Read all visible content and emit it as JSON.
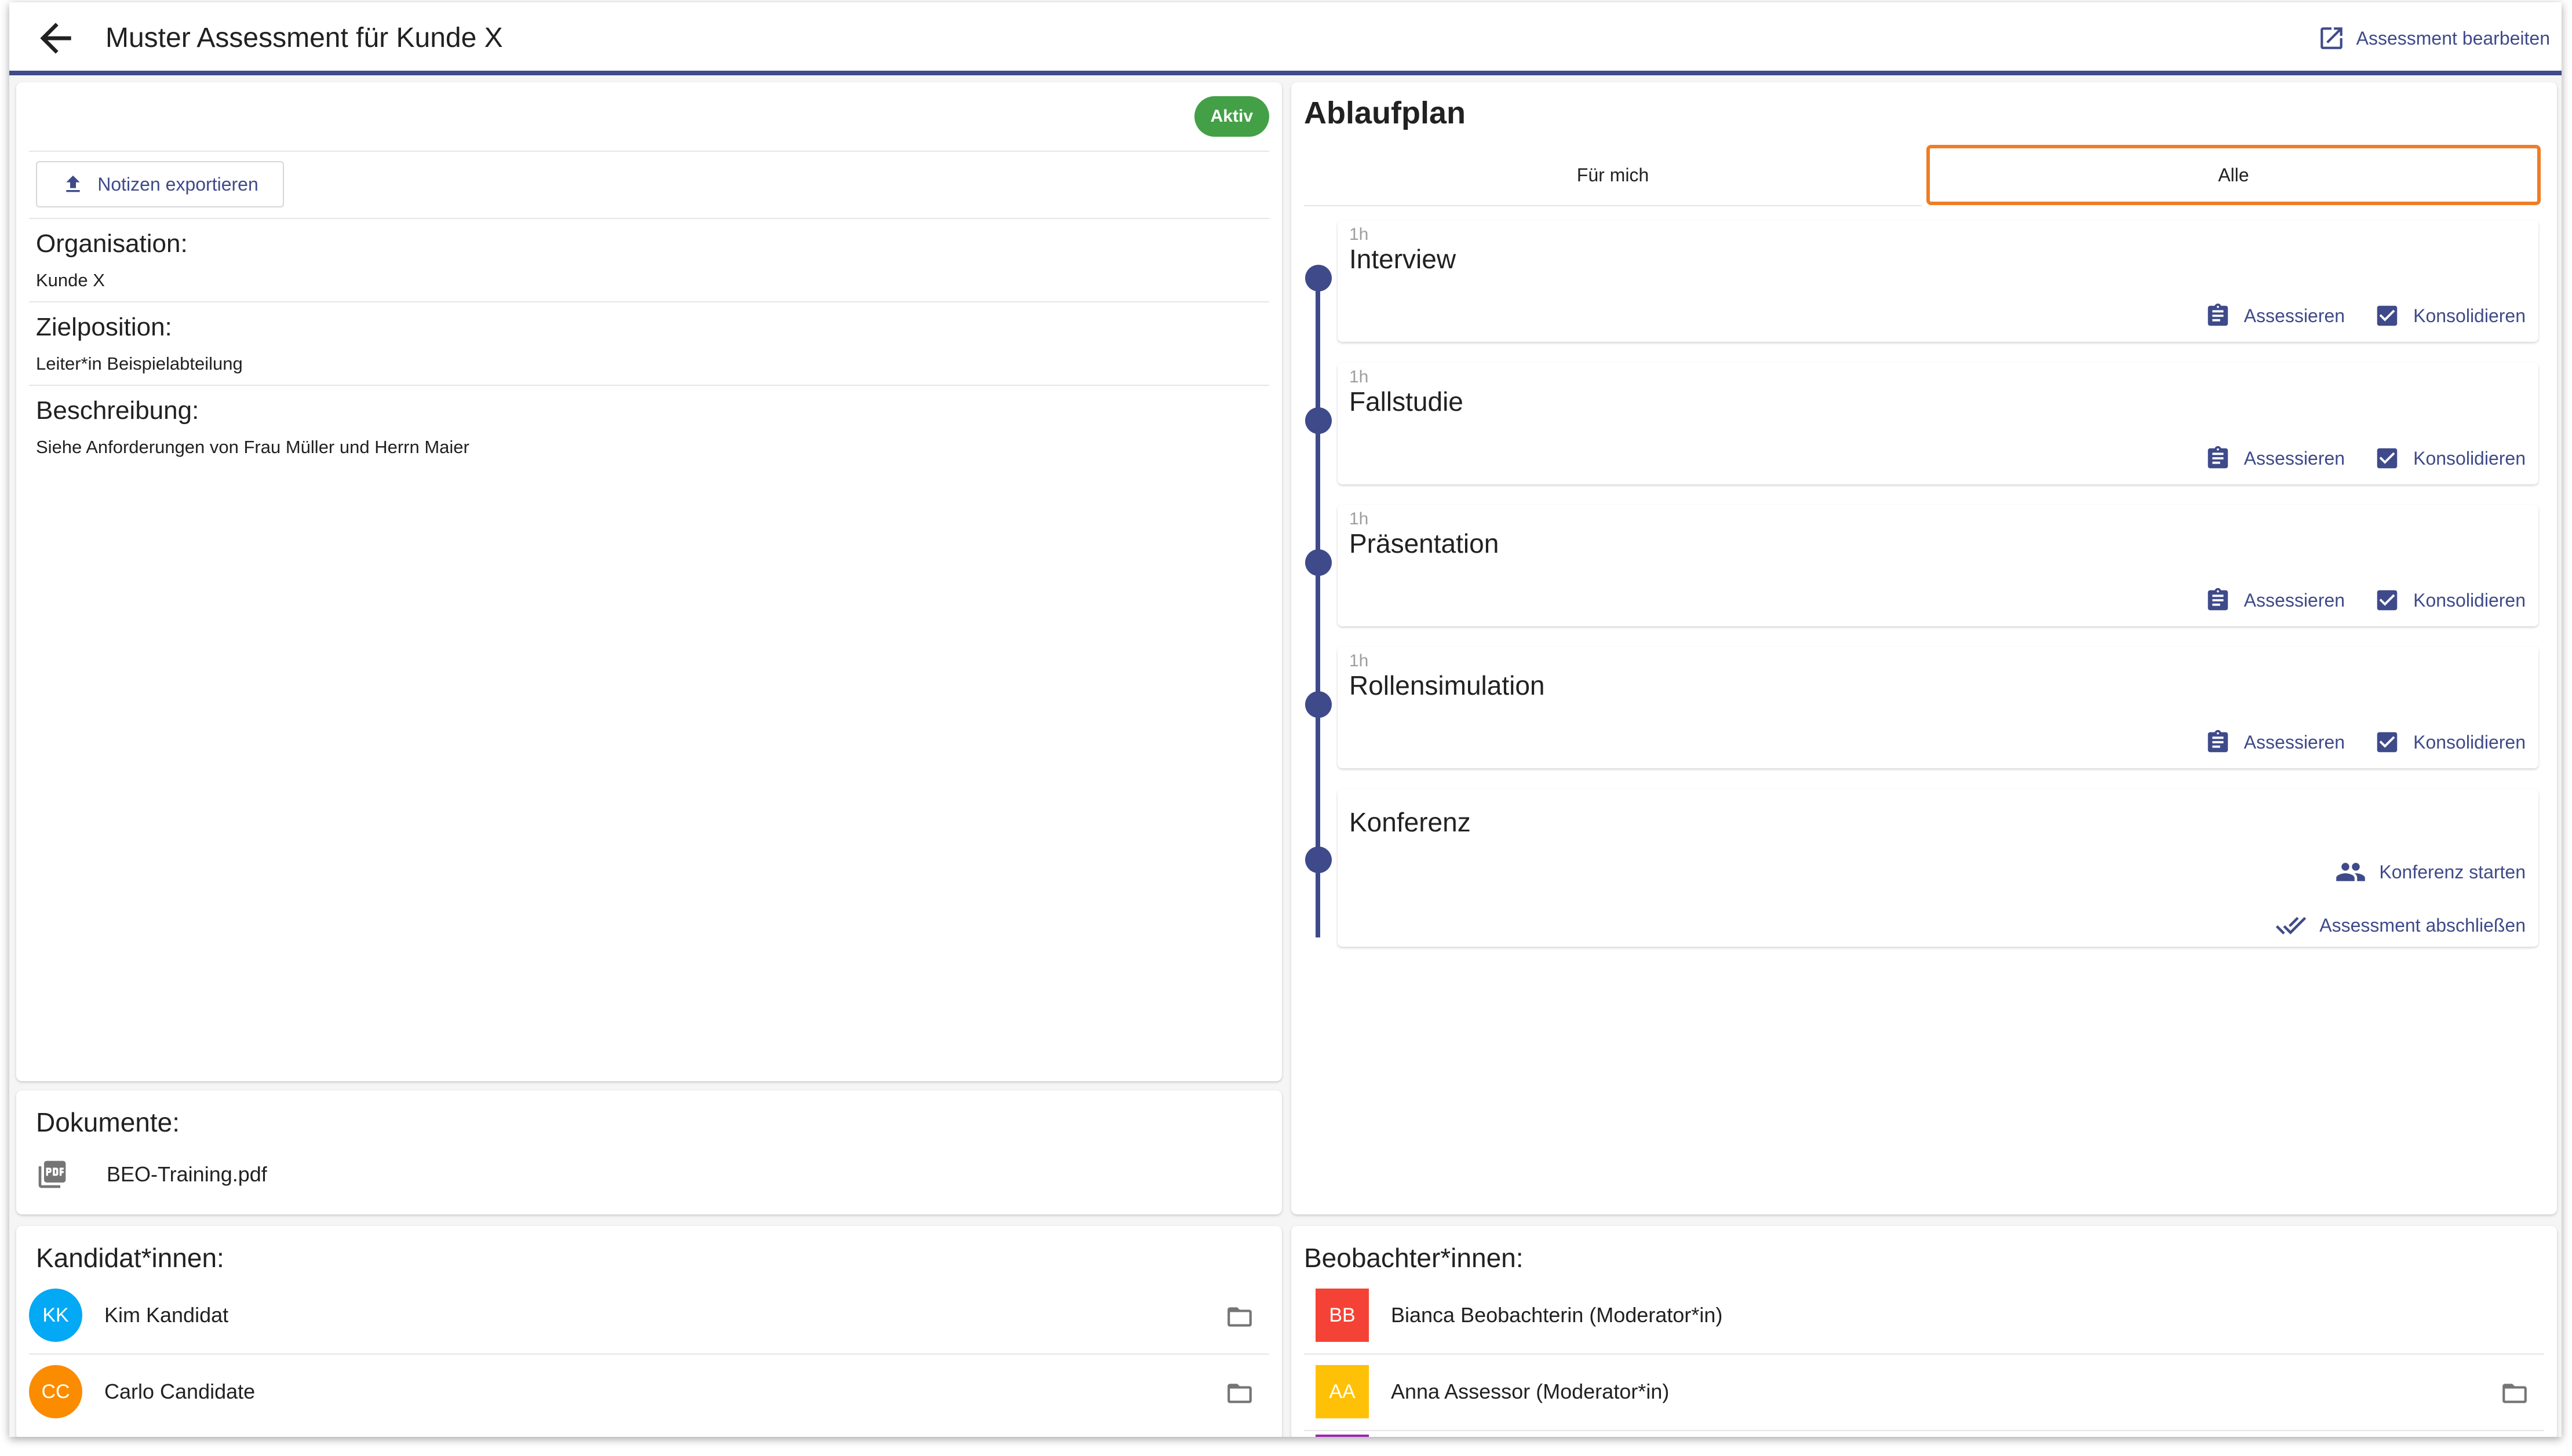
{
  "header": {
    "title": "Muster Assessment für Kunde X",
    "edit_label": "Assessment bearbeiten"
  },
  "info": {
    "status": "Aktiv",
    "export_label": "Notizen exportieren",
    "fields": [
      {
        "label": "Organisation:",
        "value": "Kunde X"
      },
      {
        "label": "Zielposition:",
        "value": "Leiter*in Beispielabteilung"
      },
      {
        "label": "Beschreibung:",
        "value": "Siehe Anforderungen von Frau Müller und Herrn Maier"
      }
    ]
  },
  "documents": {
    "title": "Dokumente:",
    "items": [
      {
        "name": "BEO-Training.pdf",
        "icon": "pdf-icon"
      }
    ]
  },
  "plan": {
    "title": "Ablaufplan",
    "tabs": [
      {
        "label": "Für mich",
        "selected": false
      },
      {
        "label": "Alle",
        "selected": true
      }
    ],
    "steps": [
      {
        "duration": "1h",
        "name": "Interview",
        "actions": [
          "Assessieren",
          "Konsolidieren"
        ]
      },
      {
        "duration": "1h",
        "name": "Fallstudie",
        "actions": [
          "Assessieren",
          "Konsolidieren"
        ]
      },
      {
        "duration": "1h",
        "name": "Präsentation",
        "actions": [
          "Assessieren",
          "Konsolidieren"
        ]
      },
      {
        "duration": "1h",
        "name": "Rollensimulation",
        "actions": [
          "Assessieren",
          "Konsolidieren"
        ]
      }
    ],
    "conference": {
      "name": "Konferenz",
      "start_label": "Konferenz starten",
      "finish_label": "Assessment abschließen"
    }
  },
  "candidates": {
    "title": "Kandidat*innen:",
    "items": [
      {
        "initials": "KK",
        "name": "Kim Kandidat",
        "color": "#03a9f4"
      },
      {
        "initials": "CC",
        "name": "Carlo Candidate",
        "color": "#fb8c00"
      }
    ]
  },
  "observers": {
    "title": "Beobachter*innen:",
    "items": [
      {
        "initials": "BB",
        "name": "Bianca Beobachterin (Moderator*in)",
        "color": "#f44336",
        "has_folder": false
      },
      {
        "initials": "AA",
        "name": "Anna Assessor (Moderator*in)",
        "color": "#ffc107",
        "has_folder": true
      }
    ],
    "partial_next_color": "#9c27b0"
  },
  "colors": {
    "accent": "#3f4a8a",
    "status_green": "#43a047",
    "highlight_orange": "#ee7d26"
  }
}
